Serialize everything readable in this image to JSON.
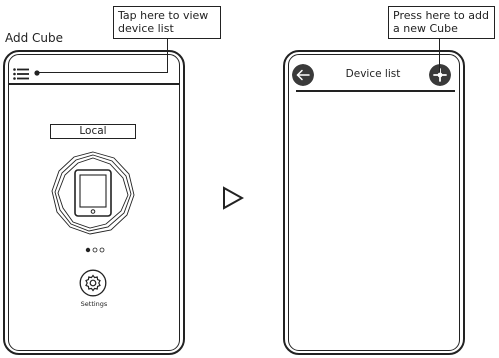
{
  "page": {
    "title": "Add Cube"
  },
  "callouts": {
    "device_list": "Tap here to view device list",
    "add_cube": "Press here to add a new Cube"
  },
  "home_screen": {
    "location_label": "Local",
    "pager_total": 3,
    "pager_active": 1,
    "settings_label": "Settings"
  },
  "device_list_screen": {
    "title": "Device list"
  },
  "icons": {
    "menu": "hamburger-menu-icon",
    "cube": "cube-tablet-icon",
    "settings": "gear-icon",
    "back": "arrow-left-icon",
    "add": "plus-icon",
    "transition": "play-triangle-icon"
  },
  "colors": {
    "line": "#222222",
    "button_fill": "#3a3a3a",
    "button_glyph": "#ffffff"
  }
}
